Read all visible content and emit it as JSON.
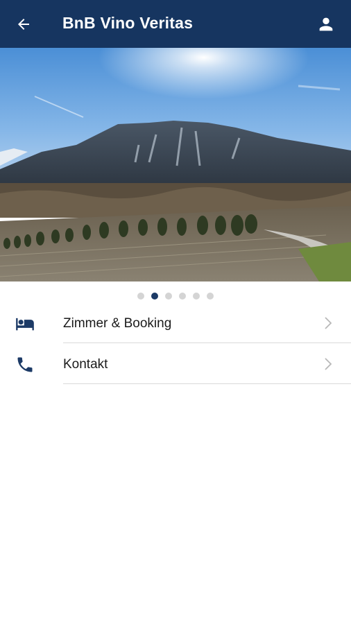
{
  "app_bar": {
    "title": "BnB Vino Veritas",
    "back_icon": "arrow-left-icon",
    "profile_icon": "person-icon",
    "background": "#163560"
  },
  "carousel": {
    "page_count": 6,
    "active_page": 2,
    "image": "mountain vineyard landscape"
  },
  "menu": {
    "items": [
      {
        "label": "Zimmer & Booking",
        "icon": "bed-icon"
      },
      {
        "label": "Kontakt",
        "icon": "phone-icon"
      }
    ],
    "chevron_icon": "chevron-right-icon"
  },
  "colors": {
    "accent": "#1c3a66",
    "dot_inactive": "#d4d4d4",
    "divider": "#d9d9d9"
  }
}
